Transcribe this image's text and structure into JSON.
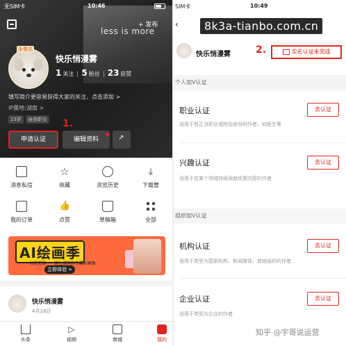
{
  "left": {
    "status": {
      "carrier": "无SIM卡",
      "time": "10:46"
    },
    "header": {
      "publish_label": "+ 发布",
      "photo_text": "less is more"
    },
    "profile": {
      "avatar_badge": "永卷达",
      "name": "快乐悄漫雾",
      "follow_count": "1",
      "follow_label": "关注",
      "fans_count": "5",
      "fans_label": "粉丝",
      "likes_count": "23",
      "likes_label": "获赞",
      "intro": "填写简介更容易获得大家的关注，点击添加 >",
      "ip": "IP属地:湖南 >",
      "tags": [
        "23岁",
        "自由职业"
      ]
    },
    "actions": {
      "apply_label": "申请认证",
      "edit_label": "编辑资料",
      "step_marker": "1."
    },
    "menu": [
      {
        "label": "消息私信",
        "icon": "mail-icon"
      },
      {
        "label": "收藏",
        "icon": "star-icon"
      },
      {
        "label": "浏览历史",
        "icon": "clock-icon"
      },
      {
        "label": "下载管",
        "icon": "download-icon"
      },
      {
        "label": "我的订单",
        "icon": "order-icon"
      },
      {
        "label": "点赞",
        "icon": "thumbs-up-icon"
      },
      {
        "label": "草稿箱",
        "icon": "draft-icon"
      },
      {
        "label": "全部",
        "icon": "grid-icon"
      }
    ],
    "banner": {
      "title": "AI绘画季",
      "subtitle": "创意无限 · 一键生成你的专属AI画像",
      "cta": "立即体验 >"
    },
    "feed": {
      "name": "快乐悄漫雾",
      "date": "4月18日"
    },
    "tabbar": [
      {
        "label": "头条",
        "icon": "home-icon"
      },
      {
        "label": "视频",
        "icon": "play-icon"
      },
      {
        "label": "商城",
        "icon": "shop-icon"
      },
      {
        "label": "我的",
        "icon": "mine-icon"
      }
    ]
  },
  "right": {
    "status": {
      "carrier": "SIM卡",
      "time": "10:49"
    },
    "watermark": "8k3a-tianbo.com.cn",
    "back_icon": "chevron-left-icon",
    "profile_name": "快乐悄漫雾",
    "step_marker": "2.",
    "realname_label": "实名认证未完成",
    "sections": [
      {
        "header": "个人加V认证"
      },
      {
        "header": "组织加V认证"
      }
    ],
    "certs": [
      {
        "title": "职业认证",
        "desc": "适用于有正当职业或附加身份的作者，如医生等",
        "button": "去认证"
      },
      {
        "title": "兴趣认证",
        "desc": "适用于在某个领域持续贡献优质内容的作者",
        "button": "去认证"
      },
      {
        "title": "机构认证",
        "desc": "适用于类型为国家机构、新闻媒体、其他组织的作者",
        "button": "去认证"
      },
      {
        "title": "企业认证",
        "desc": "适用于类型为企业的作者",
        "button": "去认证"
      }
    ],
    "footer_watermark": "知乎 @宇哥说运营"
  },
  "colors": {
    "accent": "#e1251b",
    "hero_bg": "#2b2b2b",
    "section_bg": "#f5f5f5"
  }
}
